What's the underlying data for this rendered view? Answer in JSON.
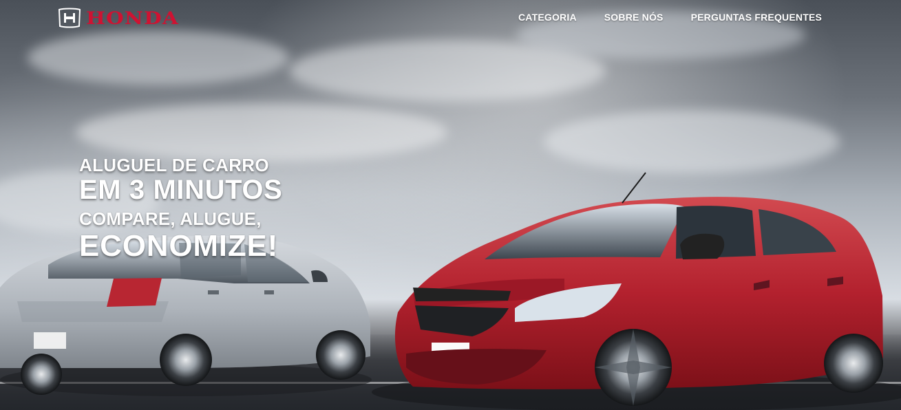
{
  "brand": {
    "name": "HONDA",
    "color": "#cf1232",
    "mark_icon": "honda-h-icon"
  },
  "nav": {
    "items": [
      {
        "label": "CATEGORIA"
      },
      {
        "label": "SOBRE NÓS"
      },
      {
        "label": "PERGUNTAS FREQUENTES"
      }
    ]
  },
  "hero": {
    "line1": "ALUGUEL DE CARRO",
    "line2": "EM 3 MINUTOS",
    "line3": "COMPARE, ALUGUE,",
    "line4": "ECONOMIZE!"
  },
  "colors": {
    "headline": "#ffffff",
    "nav_text": "#ffffff",
    "red_car": "#b3212e",
    "silver_car": "#b9bec6"
  }
}
